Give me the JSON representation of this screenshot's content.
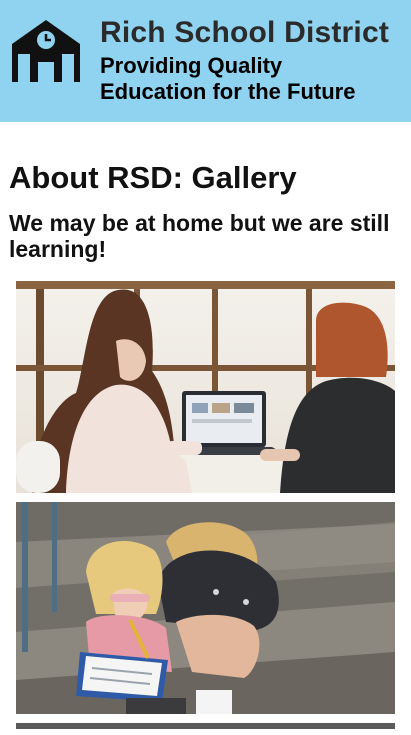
{
  "header": {
    "logo_icon": "school-building-icon",
    "title": "Rich School District",
    "tagline_line1": "Providing Quality",
    "tagline_line2": "Education for the Future",
    "background": "#8fd3f0"
  },
  "main": {
    "page_title": "About RSD: Gallery",
    "subtitle": "We may be at home but we are still learning!"
  },
  "gallery": {
    "photos": [
      {
        "description": "Two students at a table using a laptop"
      },
      {
        "description": "Two children sitting on steps writing on a clipboard"
      }
    ]
  }
}
